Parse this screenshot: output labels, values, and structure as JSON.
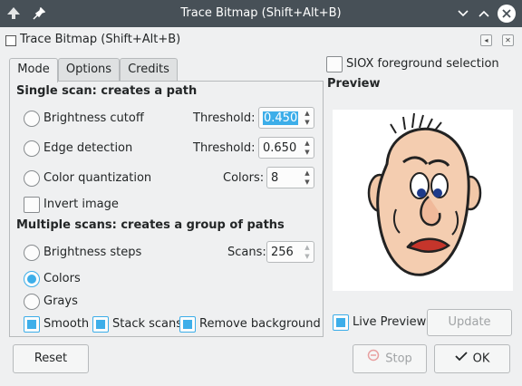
{
  "window": {
    "title": "Trace Bitmap (Shift+Alt+B)"
  },
  "dock": {
    "title": "Trace Bitmap (Shift+Alt+B)"
  },
  "tabs": [
    {
      "label": "Mode",
      "active": true
    },
    {
      "label": "Options",
      "active": false
    },
    {
      "label": "Credits",
      "active": false
    }
  ],
  "single_scan": {
    "title": "Single scan: creates a path",
    "options": [
      {
        "label": "Brightness cutoff",
        "param_label": "Threshold:",
        "value": "0.450",
        "selected": false
      },
      {
        "label": "Edge detection",
        "param_label": "Threshold:",
        "value": "0.650",
        "selected": false
      },
      {
        "label": "Color quantization",
        "param_label": "Colors:",
        "value": "8",
        "selected": false
      }
    ],
    "invert_label": "Invert image"
  },
  "multiple_scans": {
    "title": "Multiple scans: creates a group of paths",
    "options": [
      {
        "label": "Brightness steps",
        "selected": false
      },
      {
        "label": "Colors",
        "selected": true
      },
      {
        "label": "Grays",
        "selected": false
      }
    ],
    "scans_label": "Scans:",
    "scans_value": "256",
    "checks": [
      {
        "label": "Smooth",
        "checked": true
      },
      {
        "label": "Stack scans",
        "checked": true
      },
      {
        "label": "Remove background",
        "checked": true
      }
    ]
  },
  "siox_label": "SIOX foreground selection",
  "preview": {
    "title": "Preview",
    "live_label": "Live Preview",
    "update_label": "Update"
  },
  "buttons": {
    "reset": "Reset",
    "stop": "Stop",
    "ok": "OK"
  },
  "colors": {
    "accent": "#3daee9",
    "titlebar": "#475057"
  }
}
